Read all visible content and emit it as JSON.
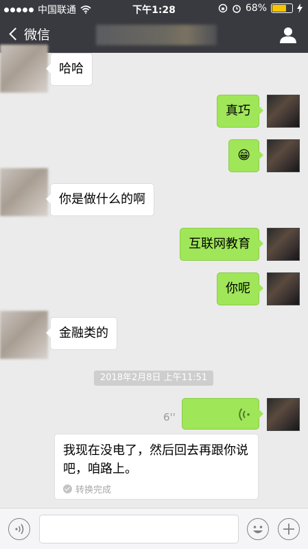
{
  "status_bar": {
    "carrier": "中国联通",
    "time": "下午1:28",
    "battery": "68%",
    "battery_level": 0.68
  },
  "nav": {
    "back_label": "微信"
  },
  "messages": [
    {
      "side": "left",
      "text": "哈哈"
    },
    {
      "side": "right",
      "text": "真巧"
    },
    {
      "side": "right",
      "text": "😁"
    },
    {
      "side": "left",
      "text": "你是做什么的啊"
    },
    {
      "side": "right",
      "text": "互联网教育"
    },
    {
      "side": "right",
      "text": "你呢"
    },
    {
      "side": "left",
      "text": "金融类的"
    }
  ],
  "timestamp": "2018年2月8日 上午11:51",
  "voice_message": {
    "duration": "6''",
    "transcript": "我现在没电了，然后回去再跟你说吧，咱路上。",
    "transcript_status": "转换完成"
  },
  "colors": {
    "header": "#393a3f",
    "own_bubble": "#9fe658",
    "background": "#ebebeb"
  }
}
